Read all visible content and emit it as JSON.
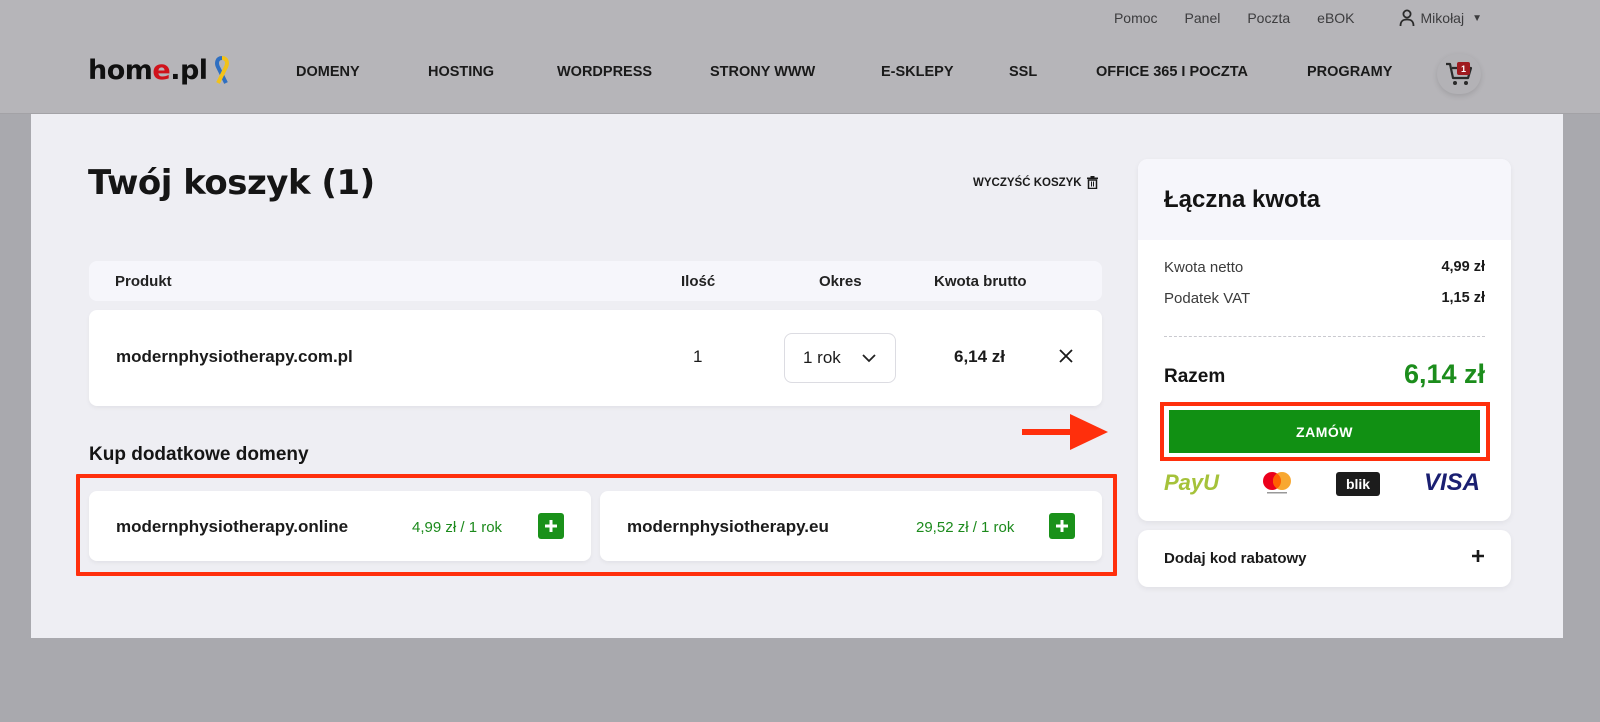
{
  "topnav": {
    "links": [
      "Pomoc",
      "Panel",
      "Poczta",
      "eBOK"
    ],
    "user_name": "Mikołaj"
  },
  "logo": {
    "part1": "hom",
    "part2": "e",
    "part3": ".pl"
  },
  "mainnav": [
    "DOMENY",
    "HOSTING",
    "WORDPRESS",
    "STRONY WWW",
    "E-SKLEPY",
    "SSL",
    "OFFICE 365 I POCZTA",
    "PROGRAMY"
  ],
  "cart": {
    "badge": "1"
  },
  "page": {
    "title": "Twój koszyk (1)",
    "clear_cart": "WYCZYŚĆ KOSZYK"
  },
  "table": {
    "headers": {
      "product": "Produkt",
      "qty": "Ilość",
      "period": "Okres",
      "price": "Kwota brutto"
    },
    "rows": [
      {
        "name": "modernphysiotherapy.com.pl",
        "qty": "1",
        "period": "1 rok",
        "price": "6,14 zł"
      }
    ]
  },
  "extra": {
    "title": "Kup dodatkowe domeny",
    "domains": [
      {
        "name": "modernphysiotherapy.online",
        "price": "4,99 zł / 1 rok"
      },
      {
        "name": "modernphysiotherapy.eu",
        "price": "29,52 zł / 1 rok"
      }
    ]
  },
  "summary": {
    "title": "Łączna kwota",
    "net_label": "Kwota netto",
    "net_value": "4,99 zł",
    "vat_label": "Podatek VAT",
    "vat_value": "1,15 zł",
    "total_label": "Razem",
    "total_value": "6,14 zł",
    "order_button": "ZAMÓW",
    "payment_logos": {
      "payu": "PayU",
      "blik": "blik",
      "visa": "VISA"
    }
  },
  "promo": {
    "label": "Dodaj kod rabatowy"
  },
  "colors": {
    "accent_green": "#119013",
    "highlight_red": "#ff2f0c",
    "logo_red": "#d0121b"
  }
}
